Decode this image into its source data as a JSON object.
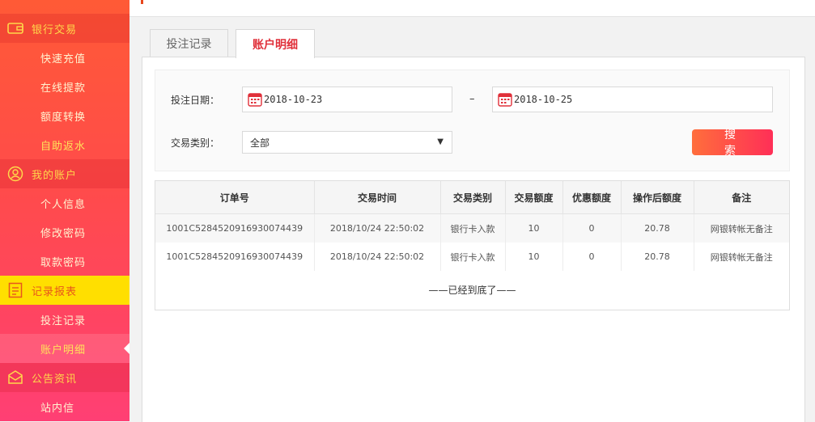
{
  "sidebar": {
    "sections": [
      {
        "label": "银行交易",
        "icon": "wallet-icon",
        "items": [
          "快速充值",
          "在线提款",
          "额度转换",
          "自助返水"
        ]
      },
      {
        "label": "我的账户",
        "icon": "user-icon",
        "items": [
          "个人信息",
          "修改密码",
          "取款密码"
        ]
      },
      {
        "label": "记录报表",
        "icon": "report-icon",
        "items": [
          "投注记录",
          "账户明细"
        ]
      },
      {
        "label": "公告资讯",
        "icon": "mail-icon",
        "items": [
          "站内信"
        ]
      }
    ]
  },
  "tabs": [
    "投注记录",
    "账户明细"
  ],
  "active_tab": "账户明细",
  "filter": {
    "date_label": "投注日期：",
    "date_from": "2018-10-23",
    "date_sep": "–",
    "date_to": "2018-10-25",
    "type_label": "交易类别：",
    "type_value": "全部",
    "search_label": "搜索"
  },
  "table": {
    "headers": [
      "订单号",
      "交易时间",
      "交易类别",
      "交易额度",
      "优惠额度",
      "操作后额度",
      "备注"
    ],
    "rows": [
      [
        "1001C5284520916930074439",
        "2018/10/24 22:50:02",
        "银行卡入款",
        "10",
        "0",
        "20.78",
        "网银转帐无备注"
      ],
      [
        "1001C5284520916930074439",
        "2018/10/24 22:50:02",
        "银行卡入款",
        "10",
        "0",
        "20.78",
        "网银转帐无备注"
      ]
    ],
    "end_note": "——已经到底了——"
  },
  "colors": {
    "accent": "#e0303a",
    "highlight": "#ffdf00",
    "sidebar_top": "#ff5a36",
    "sidebar_bottom": "#ff3f74"
  }
}
